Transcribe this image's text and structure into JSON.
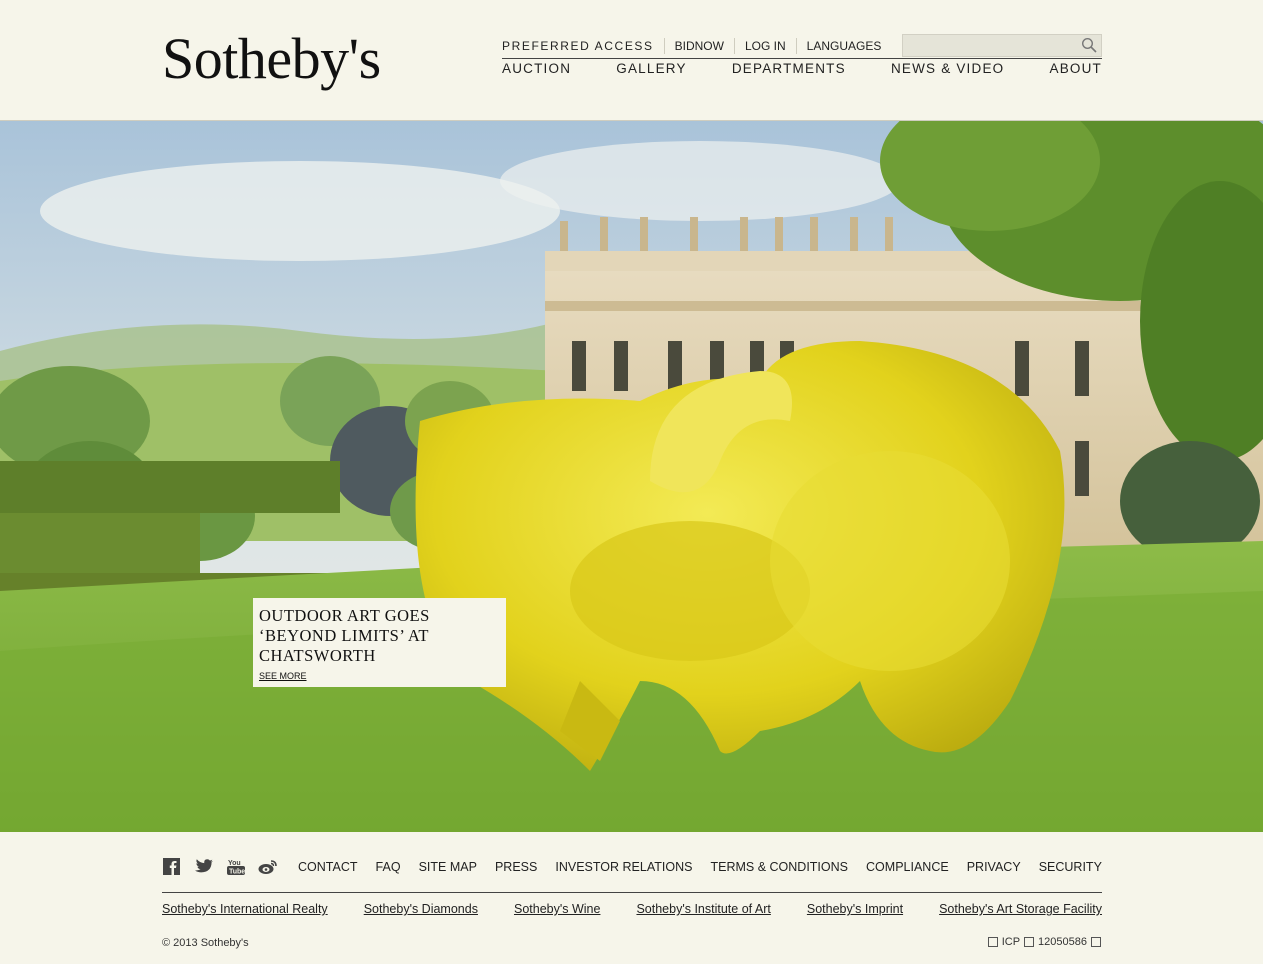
{
  "brand": {
    "logo": "Sotheby's"
  },
  "utility_nav": [
    "PREFERRED ACCESS",
    "BIDNOW",
    "LOG IN",
    "LANGUAGES"
  ],
  "search": {
    "placeholder": "",
    "icon": "search-icon"
  },
  "main_nav": [
    "AUCTION",
    "GALLERY",
    "DEPARTMENTS",
    "NEWS & VIDEO",
    "ABOUT"
  ],
  "hero": {
    "caption_title": "OUTDOOR ART GOES ‘BEYOND LIMITS’ AT CHATSWORTH",
    "see_more": "SEE MORE"
  },
  "footer": {
    "social_icons": [
      "facebook-icon",
      "twitter-icon",
      "youtube-icon",
      "weibo-icon"
    ],
    "links": [
      "CONTACT",
      "FAQ",
      "SITE MAP",
      "PRESS",
      "INVESTOR RELATIONS",
      "TERMS & CONDITIONS",
      "COMPLIANCE",
      "PRIVACY",
      "SECURITY"
    ],
    "brand_links": [
      "Sotheby's International Realty",
      "Sotheby's Diamonds",
      "Sotheby's Wine",
      "Sotheby's Institute of Art",
      "Sotheby's Imprint",
      "Sotheby's Art Storage Facility"
    ],
    "copyright": "© 2013 Sotheby's",
    "icp_label": "ICP",
    "icp_number": "12050586"
  },
  "colors": {
    "background": "#f6f5ea",
    "sculpture": "#e6d81e",
    "grass": "#7fb23a"
  }
}
